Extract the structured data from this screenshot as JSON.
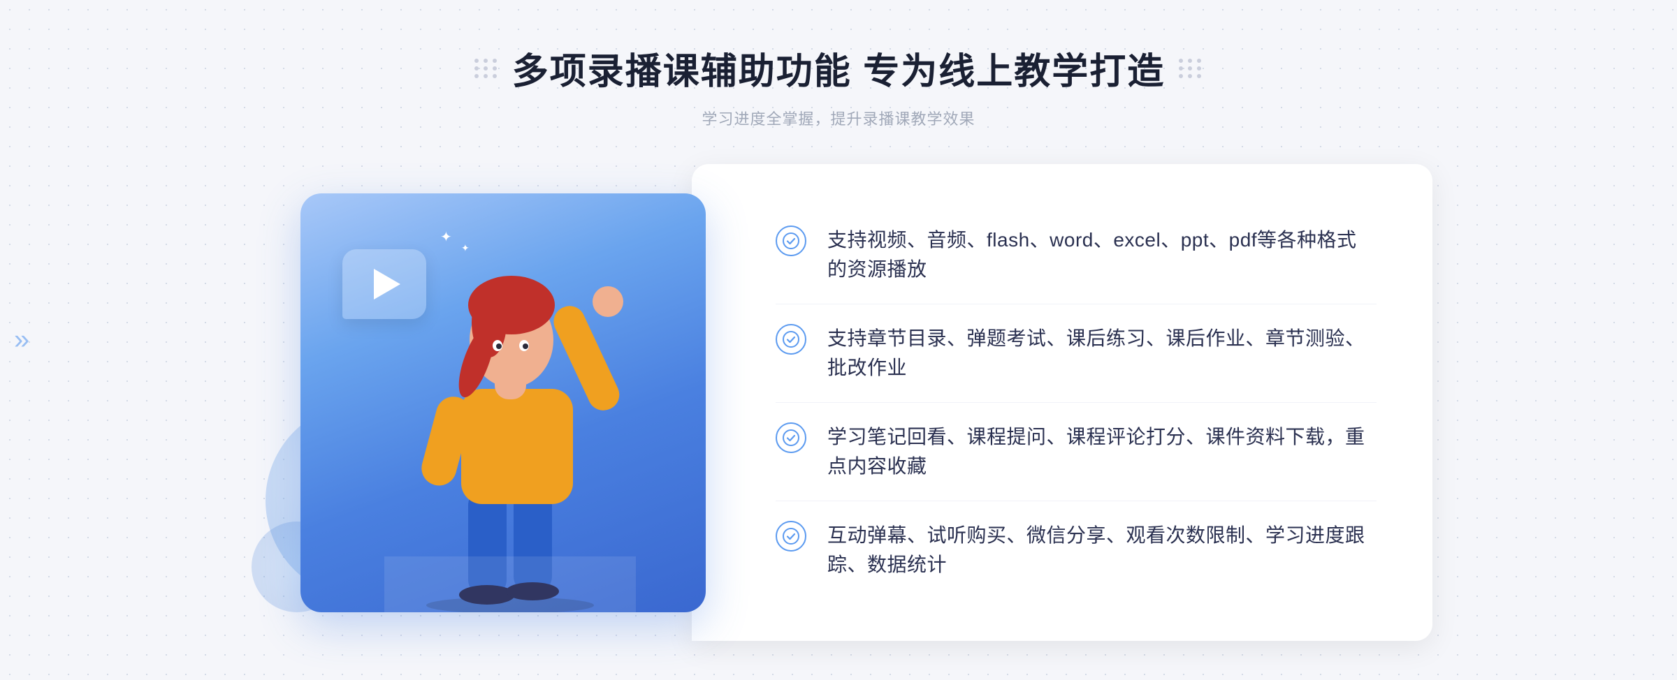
{
  "header": {
    "title": "多项录播课辅助功能 专为线上教学打造",
    "subtitle": "学习进度全掌握，提升录播课教学效果",
    "dots_left": "decorative-dots",
    "dots_right": "decorative-dots"
  },
  "features": [
    {
      "id": "feature-1",
      "text": "支持视频、音频、flash、word、excel、ppt、pdf等各种格式的资源播放"
    },
    {
      "id": "feature-2",
      "text": "支持章节目录、弹题考试、课后练习、课后作业、章节测验、批改作业"
    },
    {
      "id": "feature-3",
      "text": "学习笔记回看、课程提问、课程评论打分、课件资料下载，重点内容收藏"
    },
    {
      "id": "feature-4",
      "text": "互动弹幕、试听购买、微信分享、观看次数限制、学习进度跟踪、数据统计"
    }
  ],
  "illustration": {
    "play_label": "▶",
    "alt": "online learning illustration"
  },
  "colors": {
    "primary_blue": "#4a7fd4",
    "light_blue": "#a8c8f8",
    "check_blue": "#5b9af0",
    "text_dark": "#2a3050",
    "text_gray": "#a0a8b8"
  }
}
